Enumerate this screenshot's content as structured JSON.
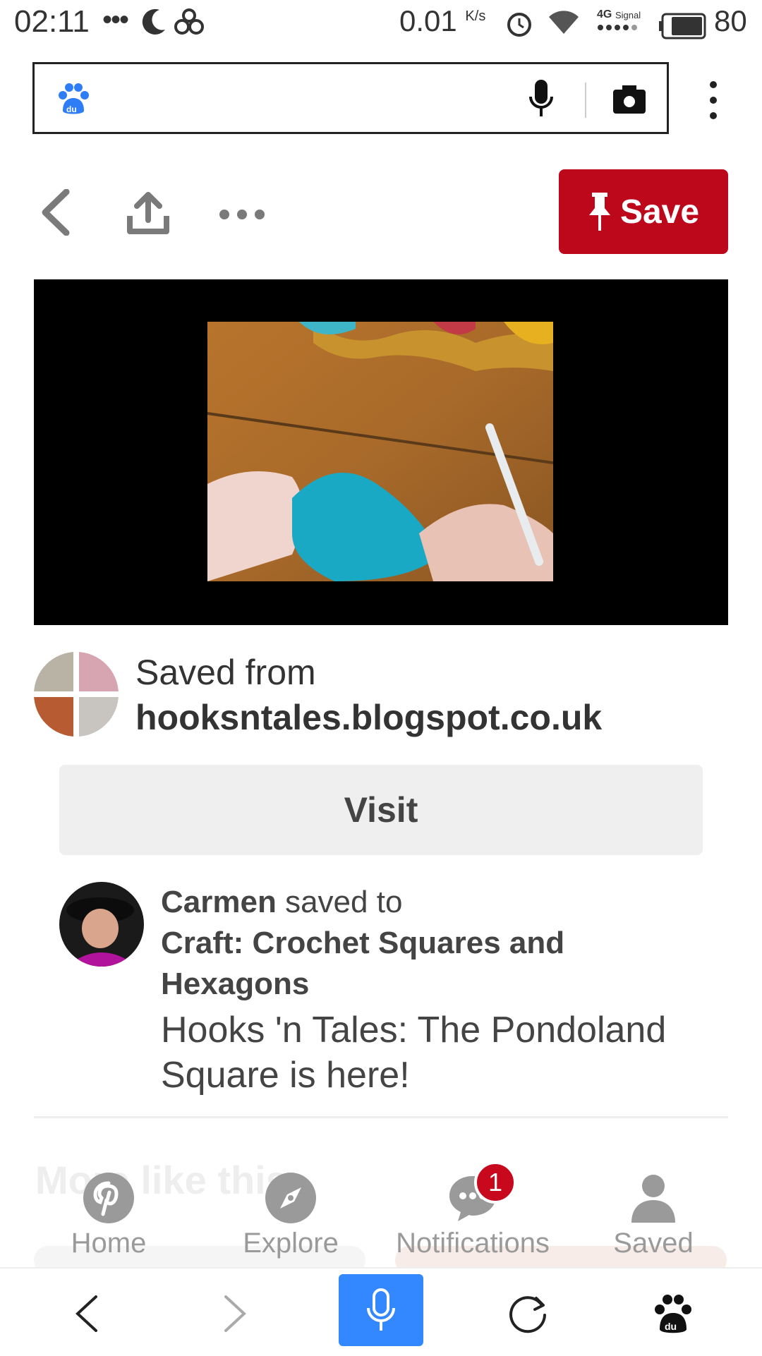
{
  "status_bar": {
    "time": "02:11",
    "extra": "•••",
    "speed": "0.01",
    "speed_unit": "K/s",
    "network": "4G",
    "signal_label": "Signal",
    "battery": "80"
  },
  "search": {
    "placeholder": ""
  },
  "toolbar": {
    "save_label": "Save"
  },
  "source": {
    "saved_from_label": "Saved from",
    "domain": "hooksntales.blogspot.co.uk",
    "visit_label": "Visit"
  },
  "pinner": {
    "name": "Carmen",
    "saved_to": "saved to",
    "board": "Craft: Crochet Squares and Hexagons",
    "description": "Hooks 'n Tales: The Pondoland Square is here!"
  },
  "more_like_this": "More like this",
  "tabs": [
    {
      "label": "Home",
      "icon": "pinterest-icon"
    },
    {
      "label": "Explore",
      "icon": "compass-icon"
    },
    {
      "label": "Notifications",
      "icon": "chat-bubble-icon",
      "badge": "1"
    },
    {
      "label": "Saved",
      "icon": "person-icon"
    }
  ],
  "colors": {
    "accent": "#bd081c",
    "browser_blue": "#3388ff"
  }
}
